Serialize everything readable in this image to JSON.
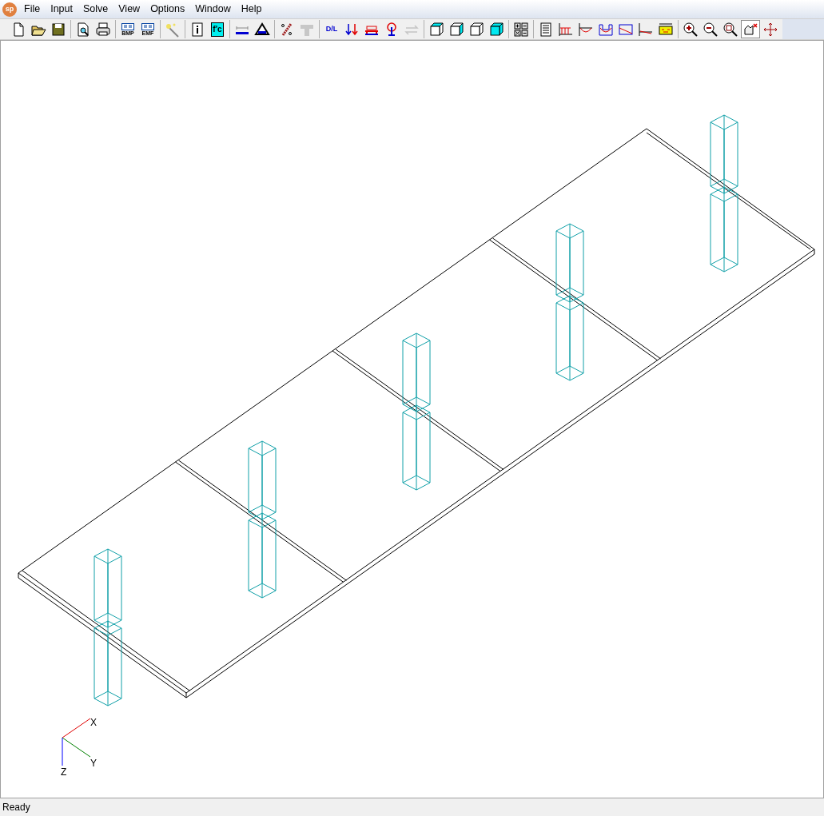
{
  "app_icon": {
    "label": "sp"
  },
  "menu": [
    {
      "label": "File"
    },
    {
      "label": "Input"
    },
    {
      "label": "Solve"
    },
    {
      "label": "View"
    },
    {
      "label": "Options"
    },
    {
      "label": "Window"
    },
    {
      "label": "Help"
    }
  ],
  "toolbar": [
    [
      {
        "kind": "new",
        "disabled": false,
        "selected": false
      },
      {
        "kind": "open",
        "disabled": false,
        "selected": false
      },
      {
        "kind": "save",
        "disabled": false,
        "selected": false
      }
    ],
    [
      {
        "kind": "preview",
        "disabled": false,
        "selected": false
      },
      {
        "kind": "print",
        "disabled": false,
        "selected": false
      }
    ],
    [
      {
        "kind": "export",
        "label": "BMP",
        "disabled": false,
        "selected": false
      },
      {
        "kind": "export",
        "label": "EMF",
        "disabled": false,
        "selected": false
      }
    ],
    [
      {
        "kind": "wizard",
        "disabled": false,
        "selected": false
      }
    ],
    [
      {
        "kind": "info",
        "disabled": false,
        "selected": false
      },
      {
        "kind": "material",
        "label": "f'c",
        "disabled": false,
        "selected": false
      }
    ],
    [
      {
        "kind": "span",
        "disabled": false,
        "selected": false
      },
      {
        "kind": "support",
        "disabled": false,
        "selected": false
      }
    ],
    [
      {
        "kind": "rebar",
        "disabled": false,
        "selected": false
      },
      {
        "kind": "tee",
        "disabled": true,
        "selected": false
      }
    ],
    [
      {
        "kind": "dl",
        "label": "D/L",
        "disabled": false,
        "selected": false
      },
      {
        "kind": "loads",
        "disabled": false,
        "selected": false
      },
      {
        "kind": "distributed",
        "disabled": false,
        "selected": false
      },
      {
        "kind": "moment",
        "disabled": false,
        "selected": false
      },
      {
        "kind": "swap",
        "disabled": true,
        "selected": false
      }
    ],
    [
      {
        "kind": "cube-top",
        "disabled": false,
        "selected": false
      },
      {
        "kind": "cube-left",
        "disabled": false,
        "selected": false
      },
      {
        "kind": "cube-right",
        "disabled": false,
        "selected": false
      },
      {
        "kind": "cube-solid",
        "disabled": false,
        "selected": false
      }
    ],
    [
      {
        "kind": "calc",
        "disabled": false,
        "selected": false
      }
    ],
    [
      {
        "kind": "table",
        "disabled": false,
        "selected": false
      },
      {
        "kind": "diagram-bars",
        "disabled": false,
        "selected": false
      },
      {
        "kind": "diagram-curve",
        "disabled": false,
        "selected": false
      },
      {
        "kind": "diagram-envelope",
        "disabled": false,
        "selected": false
      },
      {
        "kind": "diagram-line",
        "disabled": false,
        "selected": false
      },
      {
        "kind": "diagram-deflection",
        "disabled": false,
        "selected": false
      },
      {
        "kind": "diagram-section",
        "disabled": false,
        "selected": false
      }
    ],
    [
      {
        "kind": "zoom-in",
        "disabled": false,
        "selected": false
      },
      {
        "kind": "zoom-out",
        "disabled": false,
        "selected": false
      },
      {
        "kind": "zoom-fit",
        "disabled": false,
        "selected": false
      },
      {
        "kind": "rotate",
        "disabled": false,
        "selected": true
      },
      {
        "kind": "pan",
        "disabled": false,
        "selected": false
      }
    ]
  ],
  "axes": {
    "x_label": "X",
    "y_label": "Y",
    "z_label": "Z"
  },
  "status_bar": {
    "text": "Ready"
  }
}
